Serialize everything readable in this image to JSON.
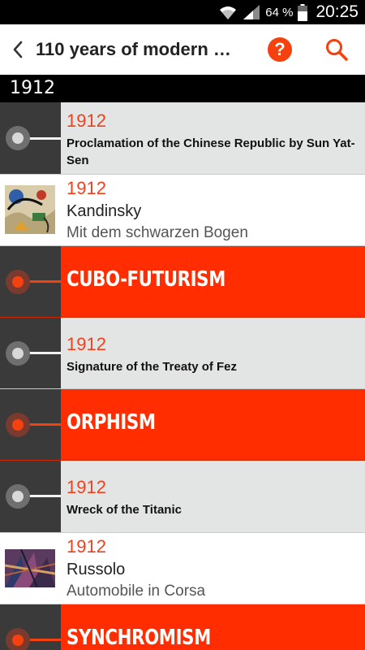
{
  "status_bar": {
    "battery_percent": "64 %",
    "time": "20:25"
  },
  "action_bar": {
    "title": "110 years of modern a…",
    "help_label": "?"
  },
  "section": {
    "year": "1912"
  },
  "items": [
    {
      "type": "event",
      "year": "1912",
      "title": "Proclamation of the Chinese Republic by Sun Yat-Sen"
    },
    {
      "type": "art",
      "year": "1912",
      "artist": "Kandinsky",
      "artwork": "Mit dem schwarzen Bogen"
    },
    {
      "type": "movement",
      "title": "CUBO-FUTURISM"
    },
    {
      "type": "event",
      "year": "1912",
      "title": "Signature of the Treaty of Fez"
    },
    {
      "type": "movement",
      "title": "ORPHISM"
    },
    {
      "type": "event",
      "year": "1912",
      "title": "Wreck of the Titanic"
    },
    {
      "type": "art",
      "year": "1912",
      "artist": "Russolo",
      "artwork": "Automobile in Corsa"
    },
    {
      "type": "movement",
      "title": "SYNCHROMISM"
    }
  ],
  "colors": {
    "accent": "#ff2d00",
    "rail": "#3a3a3a",
    "event_bg": "#e3e5e4"
  }
}
